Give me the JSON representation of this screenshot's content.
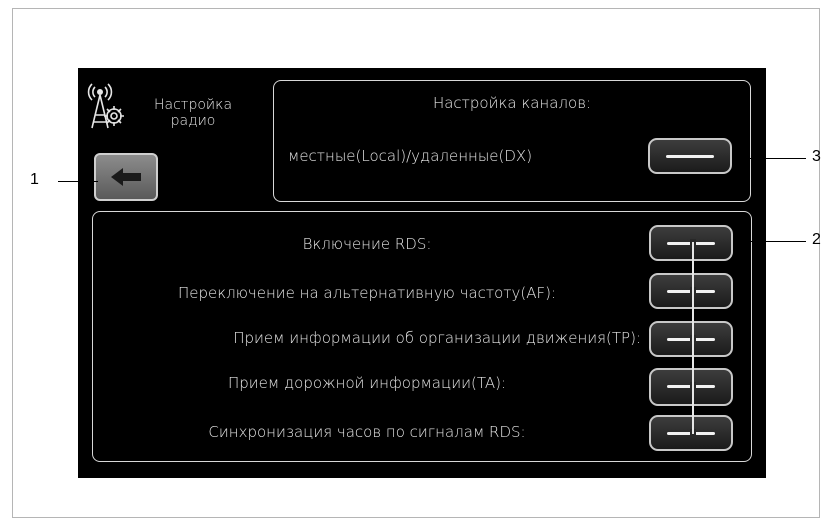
{
  "header": {
    "title_line1": "Настройка",
    "title_line2": "радио"
  },
  "channels": {
    "heading": "Настройка каналов:",
    "local_dx_label": "местные(Local)/удаленные(DX)"
  },
  "rds_options": [
    {
      "label": "Включение RDS:"
    },
    {
      "label": "Переключение на альтернативную частоту(AF):"
    },
    {
      "label": "Прием информации об организации движения(TP):"
    },
    {
      "label": "Прием дорожной информации(TA):"
    },
    {
      "label": "Синхронизация часов по сигналам RDS:"
    }
  ],
  "callouts": {
    "back": "1",
    "rds_toggles": "2",
    "local_dx_toggle": "3"
  },
  "icons": {
    "radio": "radio-settings-icon",
    "back": "back-arrow-icon"
  },
  "colors": {
    "screen": "#000000",
    "text": "#e6e6e6",
    "border": "#d8d8d8"
  }
}
